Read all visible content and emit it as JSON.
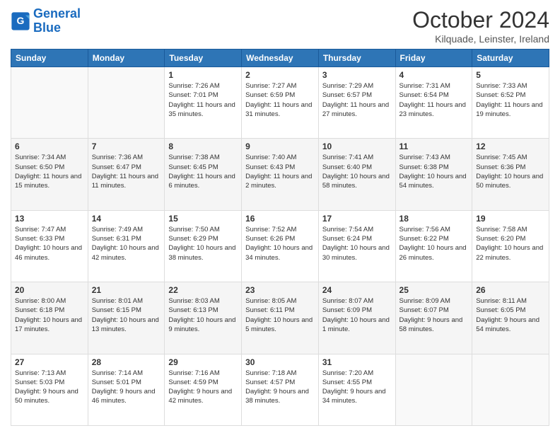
{
  "logo": {
    "line1": "General",
    "line2": "Blue"
  },
  "title": "October 2024",
  "subtitle": "Kilquade, Leinster, Ireland",
  "days_of_week": [
    "Sunday",
    "Monday",
    "Tuesday",
    "Wednesday",
    "Thursday",
    "Friday",
    "Saturday"
  ],
  "weeks": [
    [
      {
        "day": "",
        "info": ""
      },
      {
        "day": "",
        "info": ""
      },
      {
        "day": "1",
        "info": "Sunrise: 7:26 AM\nSunset: 7:01 PM\nDaylight: 11 hours and 35 minutes."
      },
      {
        "day": "2",
        "info": "Sunrise: 7:27 AM\nSunset: 6:59 PM\nDaylight: 11 hours and 31 minutes."
      },
      {
        "day": "3",
        "info": "Sunrise: 7:29 AM\nSunset: 6:57 PM\nDaylight: 11 hours and 27 minutes."
      },
      {
        "day": "4",
        "info": "Sunrise: 7:31 AM\nSunset: 6:54 PM\nDaylight: 11 hours and 23 minutes."
      },
      {
        "day": "5",
        "info": "Sunrise: 7:33 AM\nSunset: 6:52 PM\nDaylight: 11 hours and 19 minutes."
      }
    ],
    [
      {
        "day": "6",
        "info": "Sunrise: 7:34 AM\nSunset: 6:50 PM\nDaylight: 11 hours and 15 minutes."
      },
      {
        "day": "7",
        "info": "Sunrise: 7:36 AM\nSunset: 6:47 PM\nDaylight: 11 hours and 11 minutes."
      },
      {
        "day": "8",
        "info": "Sunrise: 7:38 AM\nSunset: 6:45 PM\nDaylight: 11 hours and 6 minutes."
      },
      {
        "day": "9",
        "info": "Sunrise: 7:40 AM\nSunset: 6:43 PM\nDaylight: 11 hours and 2 minutes."
      },
      {
        "day": "10",
        "info": "Sunrise: 7:41 AM\nSunset: 6:40 PM\nDaylight: 10 hours and 58 minutes."
      },
      {
        "day": "11",
        "info": "Sunrise: 7:43 AM\nSunset: 6:38 PM\nDaylight: 10 hours and 54 minutes."
      },
      {
        "day": "12",
        "info": "Sunrise: 7:45 AM\nSunset: 6:36 PM\nDaylight: 10 hours and 50 minutes."
      }
    ],
    [
      {
        "day": "13",
        "info": "Sunrise: 7:47 AM\nSunset: 6:33 PM\nDaylight: 10 hours and 46 minutes."
      },
      {
        "day": "14",
        "info": "Sunrise: 7:49 AM\nSunset: 6:31 PM\nDaylight: 10 hours and 42 minutes."
      },
      {
        "day": "15",
        "info": "Sunrise: 7:50 AM\nSunset: 6:29 PM\nDaylight: 10 hours and 38 minutes."
      },
      {
        "day": "16",
        "info": "Sunrise: 7:52 AM\nSunset: 6:26 PM\nDaylight: 10 hours and 34 minutes."
      },
      {
        "day": "17",
        "info": "Sunrise: 7:54 AM\nSunset: 6:24 PM\nDaylight: 10 hours and 30 minutes."
      },
      {
        "day": "18",
        "info": "Sunrise: 7:56 AM\nSunset: 6:22 PM\nDaylight: 10 hours and 26 minutes."
      },
      {
        "day": "19",
        "info": "Sunrise: 7:58 AM\nSunset: 6:20 PM\nDaylight: 10 hours and 22 minutes."
      }
    ],
    [
      {
        "day": "20",
        "info": "Sunrise: 8:00 AM\nSunset: 6:18 PM\nDaylight: 10 hours and 17 minutes."
      },
      {
        "day": "21",
        "info": "Sunrise: 8:01 AM\nSunset: 6:15 PM\nDaylight: 10 hours and 13 minutes."
      },
      {
        "day": "22",
        "info": "Sunrise: 8:03 AM\nSunset: 6:13 PM\nDaylight: 10 hours and 9 minutes."
      },
      {
        "day": "23",
        "info": "Sunrise: 8:05 AM\nSunset: 6:11 PM\nDaylight: 10 hours and 5 minutes."
      },
      {
        "day": "24",
        "info": "Sunrise: 8:07 AM\nSunset: 6:09 PM\nDaylight: 10 hours and 1 minute."
      },
      {
        "day": "25",
        "info": "Sunrise: 8:09 AM\nSunset: 6:07 PM\nDaylight: 9 hours and 58 minutes."
      },
      {
        "day": "26",
        "info": "Sunrise: 8:11 AM\nSunset: 6:05 PM\nDaylight: 9 hours and 54 minutes."
      }
    ],
    [
      {
        "day": "27",
        "info": "Sunrise: 7:13 AM\nSunset: 5:03 PM\nDaylight: 9 hours and 50 minutes."
      },
      {
        "day": "28",
        "info": "Sunrise: 7:14 AM\nSunset: 5:01 PM\nDaylight: 9 hours and 46 minutes."
      },
      {
        "day": "29",
        "info": "Sunrise: 7:16 AM\nSunset: 4:59 PM\nDaylight: 9 hours and 42 minutes."
      },
      {
        "day": "30",
        "info": "Sunrise: 7:18 AM\nSunset: 4:57 PM\nDaylight: 9 hours and 38 minutes."
      },
      {
        "day": "31",
        "info": "Sunrise: 7:20 AM\nSunset: 4:55 PM\nDaylight: 9 hours and 34 minutes."
      },
      {
        "day": "",
        "info": ""
      },
      {
        "day": "",
        "info": ""
      }
    ]
  ],
  "toolbar": {}
}
